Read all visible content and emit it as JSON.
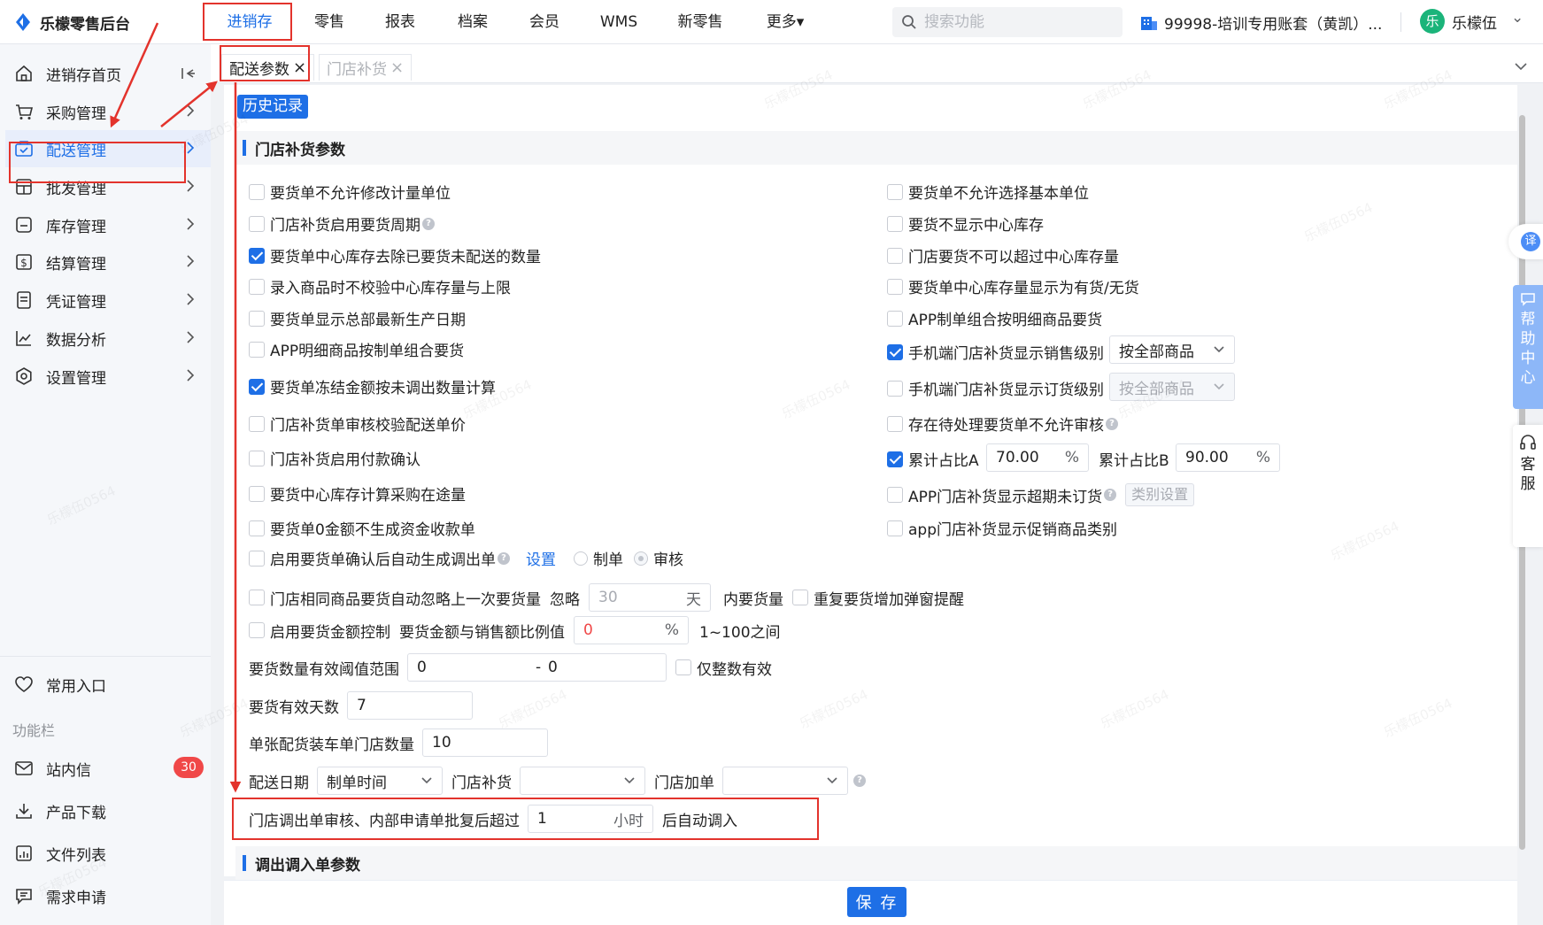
{
  "app": {
    "title": "乐檬零售后台",
    "brand_color": "#1e6fe6",
    "alert_color": "#e3332c"
  },
  "topnav": {
    "items": [
      "进销存",
      "零售",
      "报表",
      "档案",
      "会员",
      "WMS",
      "新零售",
      "更多▾"
    ],
    "active": "进销存",
    "search_placeholder": "搜索功能",
    "account": "99998-培训专用账套（黄凯）...",
    "user_avatar": "乐",
    "user_name": "乐檬伍",
    "user_chevron": "⌄"
  },
  "sidebar": {
    "items": [
      "进销存首页",
      "采购管理",
      "配送管理",
      "批发管理",
      "库存管理",
      "结算管理",
      "凭证管理",
      "数据分析",
      "设置管理"
    ],
    "active": "配送管理",
    "common_entry": "常用入口",
    "function_bar": "功能栏",
    "bottom_items": [
      "站内信",
      "产品下载",
      "文件列表",
      "需求申请"
    ],
    "inbox_count": "30"
  },
  "tabs": [
    {
      "label": "配送参数",
      "close": "×",
      "active": true
    },
    {
      "label": "门店补货",
      "close": "×",
      "active": false
    }
  ],
  "history_button": "历史记录",
  "sections": {
    "store_replenish": "门店补货参数",
    "transfer": "调出调入单参数"
  },
  "options_left": [
    {
      "label": "要货单不允许修改计量单位",
      "checked": false
    },
    {
      "label": "门店补货启用要货周期",
      "checked": false,
      "help": true
    },
    {
      "label": "要货单中心库存去除已要货未配送的数量",
      "checked": true
    },
    {
      "label": "录入商品时不校验中心库存量与上限",
      "checked": false
    },
    {
      "label": "要货单显示总部最新生产日期",
      "checked": false
    },
    {
      "label": "APP明细商品按制单组合要货",
      "checked": false
    },
    {
      "label": "要货单冻结金额按未调出数量计算",
      "checked": true
    },
    {
      "label": "门店补货单审核校验配送单价",
      "checked": false
    },
    {
      "label": "门店补货启用付款确认",
      "checked": false
    },
    {
      "label": "要货中心库存计算采购在途量",
      "checked": false
    },
    {
      "label": "要货单0金额不生成资金收款单",
      "checked": false
    }
  ],
  "options_right": [
    {
      "label": "要货单不允许选择基本单位",
      "checked": false
    },
    {
      "label": "要货不显示中心库存",
      "checked": false
    },
    {
      "label": "门店要货不可以超过中心库存量",
      "checked": false
    },
    {
      "label": "要货单中心库存量显示为有货/无货",
      "checked": false
    },
    {
      "label": "APP制单组合按明细商品要货",
      "checked": false
    },
    {
      "label": "手机端门店补货显示销售级别",
      "checked": true,
      "select": "按全部商品"
    },
    {
      "label": "手机端门店补货显示订货级别",
      "checked": false,
      "select": "按全部商品"
    },
    {
      "label": "存在待处理要货单不允许审核",
      "checked": false,
      "help": true
    },
    {
      "label": "累计占比A",
      "checked": true
    },
    {
      "label": "APP门店补货显示超期未订货",
      "checked": false,
      "help": true,
      "button": "类别设置"
    },
    {
      "label": "app门店补货显示促销商品类别",
      "checked": false
    }
  ],
  "cumulative": {
    "a_value": "70.00",
    "b_label": "累计占比B",
    "b_value": "90.00",
    "unit": "%"
  },
  "auto_transfer": {
    "label": "启用要货单确认后自动生成调出单",
    "link": "设置",
    "radio1": "制单",
    "radio2": "审核"
  },
  "same_goods": {
    "label": "门店相同商品要货自动忽略上一次要货量",
    "ignore": "忽略",
    "days_placeholder": "30",
    "days_unit": "天",
    "qty_text": "内要货量",
    "popup_label": "重复要货增加弹窗提醒"
  },
  "amount_control": {
    "label": "启用要货金额控制",
    "ratio_label": "要货金额与销售额比例值",
    "value": "0",
    "unit": "%",
    "hint": "1~100之间"
  },
  "threshold": {
    "label": "要货数量有效阈值范围",
    "from": "0",
    "sep": "-",
    "to": "0",
    "integer_only": "仅整数有效"
  },
  "valid_days": {
    "label": "要货有效天数",
    "value": "7"
  },
  "loading": {
    "label": "单张配货装车单门店数量",
    "value": "10"
  },
  "delivery_date": {
    "label": "配送日期",
    "value": "制单时间",
    "replenish_label": "门店补货",
    "replenish_value": "",
    "add_label": "门店加单",
    "add_value": ""
  },
  "auto_in": {
    "label": "门店调出单审核、内部申请单批复后超过",
    "value": "1",
    "unit": "小时",
    "suffix": "后自动调入"
  },
  "save_button": "保 存",
  "float_panels": {
    "translate": "译",
    "help_center": [
      "帮",
      "助",
      "中",
      "心"
    ],
    "service": [
      "客",
      "服"
    ]
  },
  "watermark": "乐檬伍0564"
}
